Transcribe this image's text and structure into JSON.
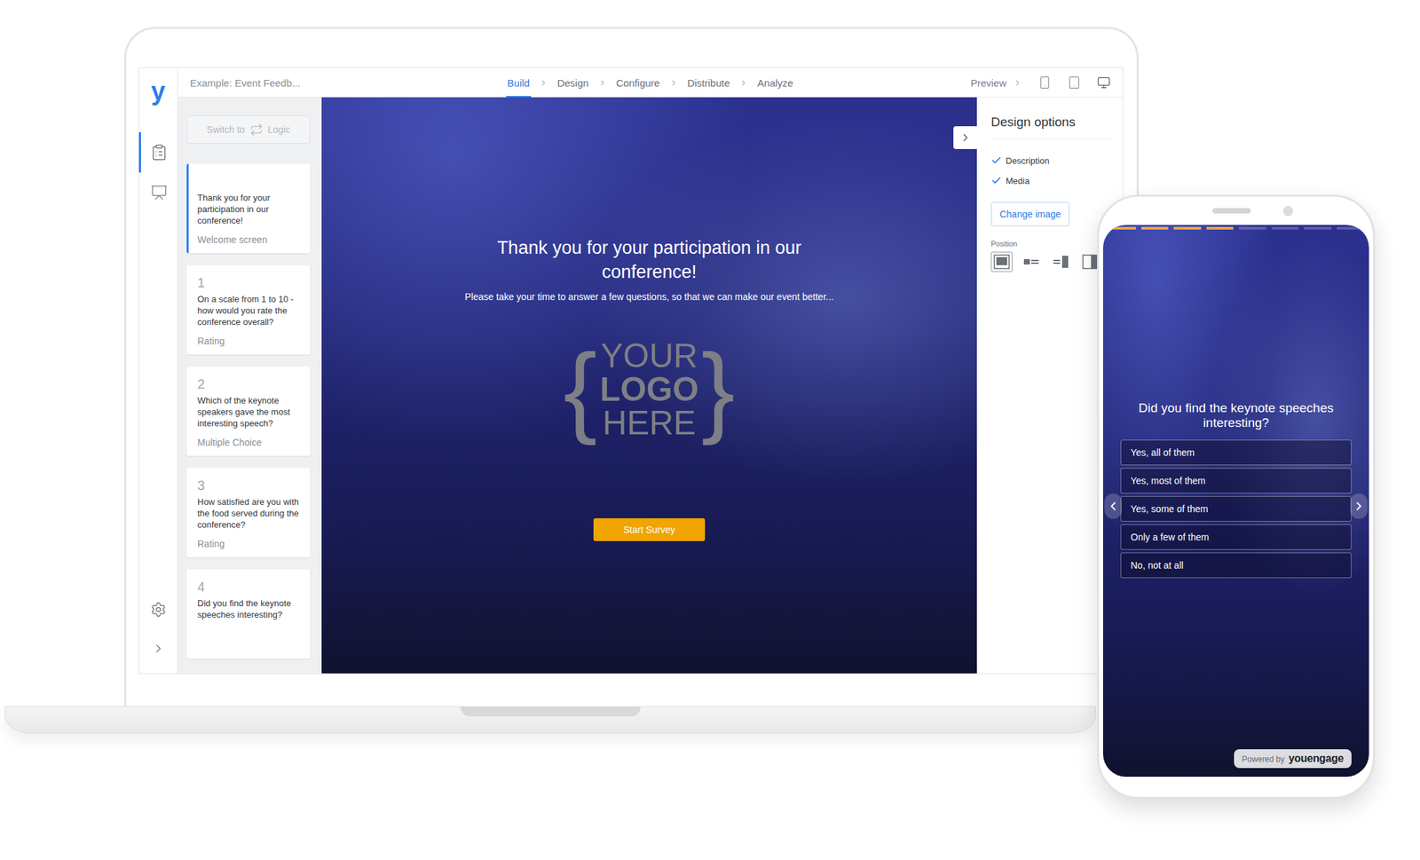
{
  "app": {
    "logo": "y",
    "survey_title": "Example: Event Feedb..."
  },
  "steps": [
    {
      "label": "Build",
      "selected": true
    },
    {
      "label": "Design",
      "selected": false
    },
    {
      "label": "Configure",
      "selected": false
    },
    {
      "label": "Distribute",
      "selected": false
    },
    {
      "label": "Analyze",
      "selected": false
    }
  ],
  "preview": {
    "label": "Preview",
    "devices": [
      {
        "kind": "phone",
        "selected": false
      },
      {
        "kind": "tablet",
        "selected": false
      },
      {
        "kind": "desktop",
        "selected": true
      }
    ]
  },
  "rail": {
    "items": [
      {
        "kind": "questions",
        "selected": true
      },
      {
        "kind": "presentation",
        "selected": false
      }
    ]
  },
  "logic_switch": {
    "prefix": "Switch to",
    "label": "Logic",
    "disabled": true
  },
  "cards": [
    {
      "number": "",
      "text": "Thank you for your participation in our conference!",
      "type": "Welcome screen",
      "selected": true
    },
    {
      "number": "1",
      "text": "On a scale from 1 to 10 - how would you rate the conference overall?",
      "type": "Rating",
      "selected": false
    },
    {
      "number": "2",
      "text": "Which of the keynote speakers gave the most interesting speech?",
      "type": "Multiple Choice",
      "selected": false
    },
    {
      "number": "3",
      "text": "How satisfied are you with the food served during the conference?",
      "type": "Rating",
      "selected": false
    },
    {
      "number": "4",
      "text": "Did you find the keynote speeches interesting?",
      "type": "",
      "selected": false
    }
  ],
  "canvas": {
    "title": "Thank you for your participation in our conference!",
    "description": "Please take your time to answer a few questions, so that we can make our event better...",
    "logo": {
      "brace_left": "{",
      "lines": [
        "YOUR",
        "LOGO",
        "HERE"
      ],
      "brace_right": "}"
    },
    "button": "Start Survey"
  },
  "design_options": {
    "title": "Design options",
    "checks": [
      {
        "label": "Description",
        "checked": true
      },
      {
        "label": "Media",
        "checked": true
      }
    ],
    "change_image": "Change image",
    "position": {
      "label": "Position",
      "options": [
        {
          "kind": "full",
          "selected": true
        },
        {
          "kind": "left",
          "selected": false
        },
        {
          "kind": "right",
          "selected": false
        },
        {
          "kind": "side",
          "selected": false
        }
      ]
    }
  },
  "phone": {
    "progress": [
      {
        "filled": true
      },
      {
        "filled": true
      },
      {
        "filled": true
      },
      {
        "filled": true
      },
      {
        "filled": false
      },
      {
        "filled": false
      },
      {
        "filled": false
      },
      {
        "filled": false
      }
    ],
    "question": "Did you find the keynote speeches interesting?",
    "options": [
      {
        "label": "Yes, all of them",
        "selected": false
      },
      {
        "label": "Yes, most of them",
        "selected": false
      },
      {
        "label": "Yes, some of them",
        "selected": false
      },
      {
        "label": "Only a few of them",
        "selected": false
      },
      {
        "label": "No, not at all",
        "selected": false
      }
    ],
    "powered_by": "Powered by",
    "brand": "youengage"
  }
}
